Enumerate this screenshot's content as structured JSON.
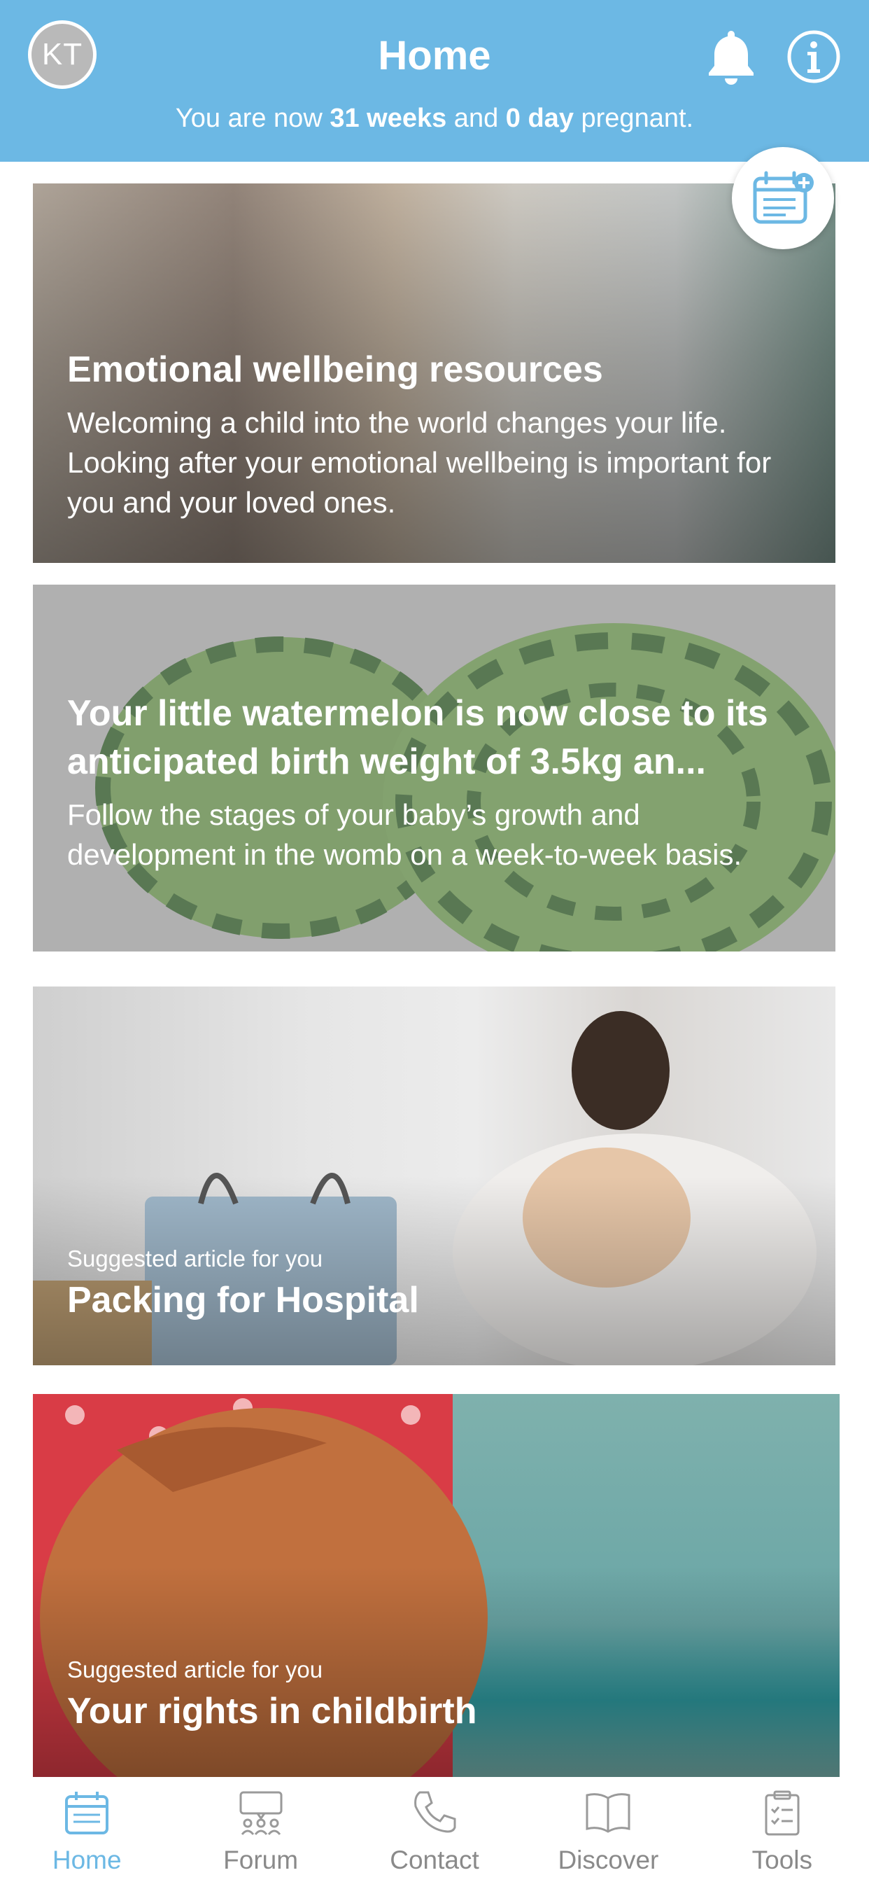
{
  "header": {
    "avatar_initials": "KT",
    "title": "Home",
    "status_prefix": "You are now ",
    "weeks": "31 weeks",
    "and_text": " and ",
    "days": "0 day",
    "status_suffix": " pregnant.",
    "bell_icon": "bell-icon",
    "info_icon": "info-icon",
    "accent_color": "#6cb8e4"
  },
  "calendar_button": {
    "icon": "calendar-add-icon"
  },
  "cards": [
    {
      "title": "Emotional wellbeing resources",
      "description": "Welcoming a child into the world changes your life. Looking after your emotional wellbeing is important for you and your loved ones."
    },
    {
      "title": "Your little watermelon is now close to its anticipated birth weight of 3.5kg an...",
      "description": "Follow the stages of your baby’s growth and development in the womb on a week-to-week basis."
    },
    {
      "label": "Suggested article for you",
      "title": "Packing for Hospital"
    },
    {
      "label": "Suggested article for you",
      "title": "Your rights in childbirth"
    }
  ],
  "tabbar": {
    "items": [
      {
        "label": "Home",
        "icon": "calendar-icon",
        "active": true
      },
      {
        "label": "Forum",
        "icon": "forum-icon"
      },
      {
        "label": "Contact",
        "icon": "phone-icon"
      },
      {
        "label": "Discover",
        "icon": "book-icon"
      },
      {
        "label": "Tools",
        "icon": "clipboard-icon"
      }
    ]
  }
}
